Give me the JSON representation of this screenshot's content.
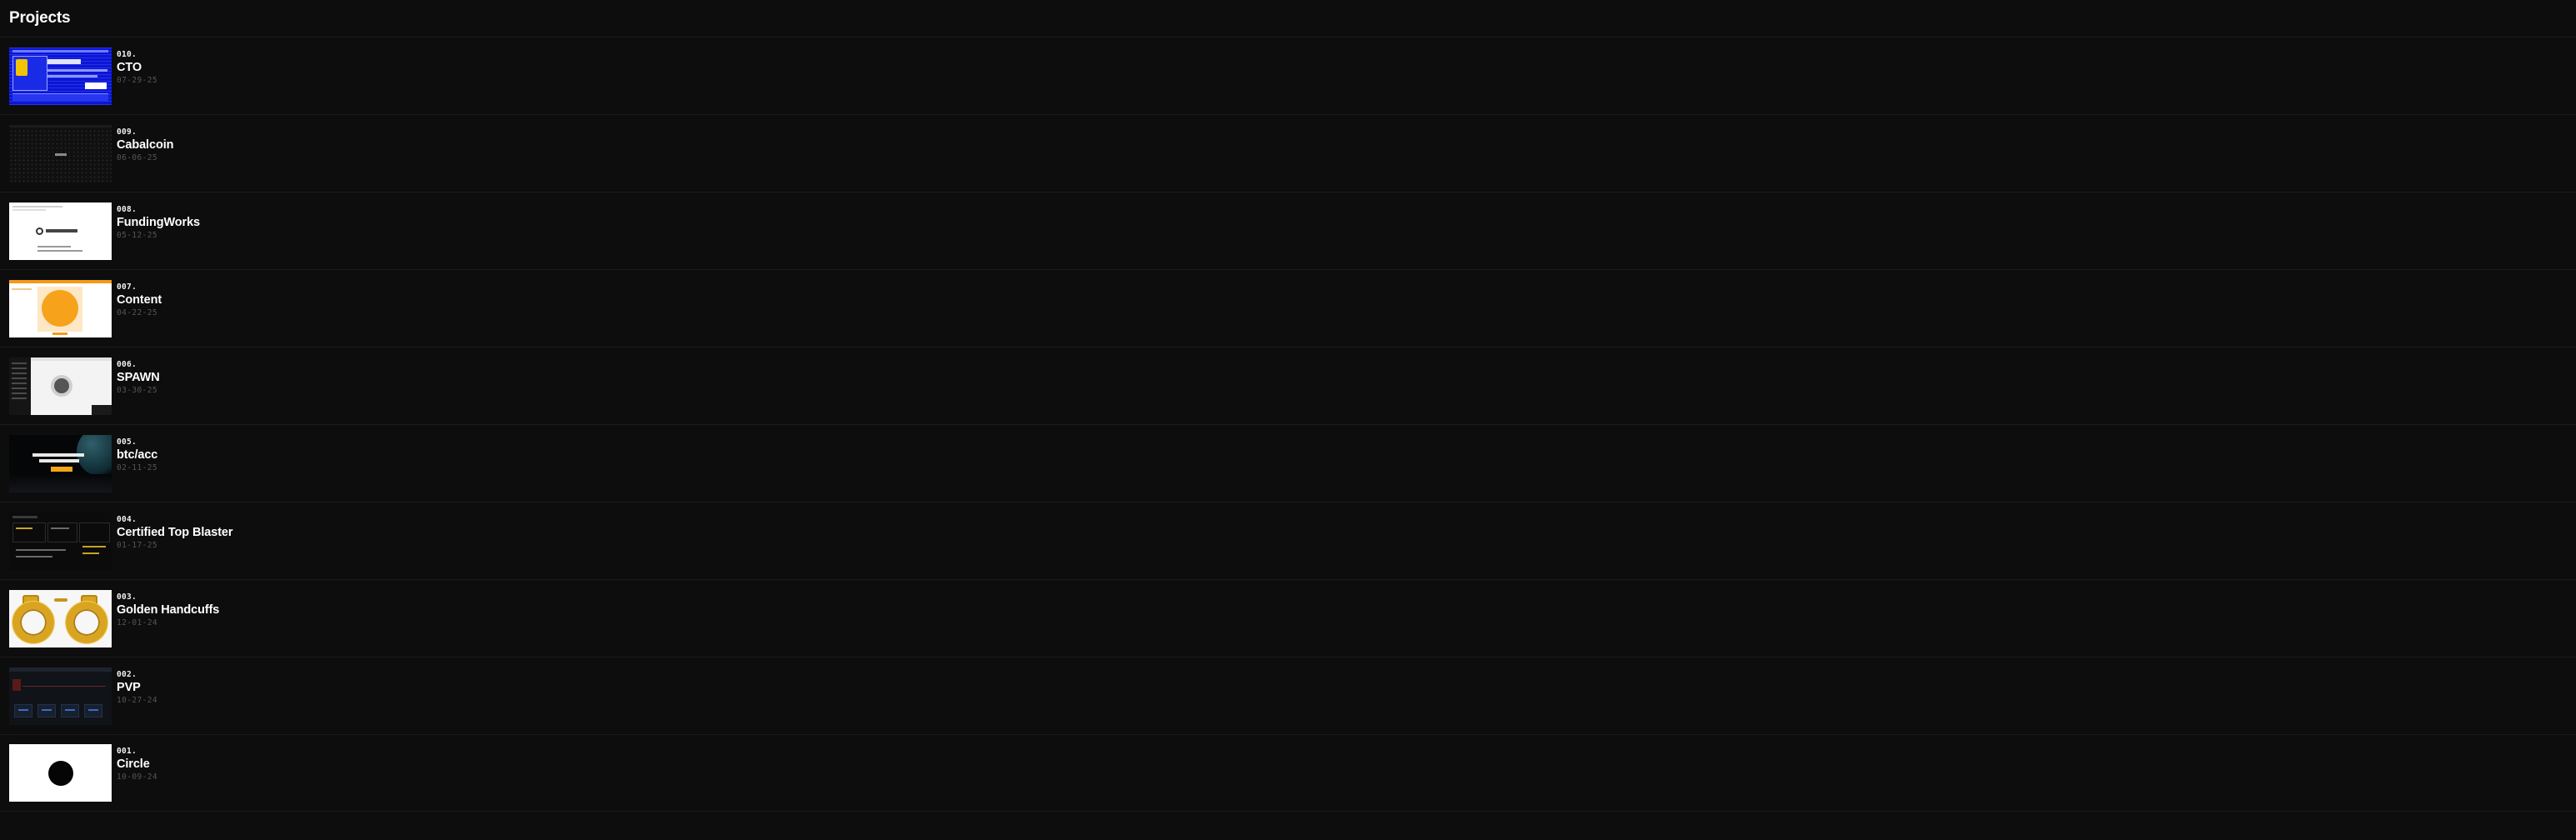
{
  "header": {
    "title": "Projects"
  },
  "projects": [
    {
      "number": "010.",
      "title": "CTO",
      "date": "07-29-25",
      "thumbnail": "cto-thumbnail"
    },
    {
      "number": "009.",
      "title": "Cabalcoin",
      "date": "06-06-25",
      "thumbnail": "cabalcoin-thumbnail"
    },
    {
      "number": "008.",
      "title": "FundingWorks",
      "date": "05-12-25",
      "thumbnail": "fundingworks-thumbnail"
    },
    {
      "number": "007.",
      "title": "Content",
      "date": "04-22-25",
      "thumbnail": "content-thumbnail"
    },
    {
      "number": "006.",
      "title": "SPAWN",
      "date": "03-30-25",
      "thumbnail": "spawn-thumbnail"
    },
    {
      "number": "005.",
      "title": "btc/acc",
      "date": "02-11-25",
      "thumbnail": "btcacc-thumbnail"
    },
    {
      "number": "004.",
      "title": "Certified Top Blaster",
      "date": "01-17-25",
      "thumbnail": "certified-top-blaster-thumbnail"
    },
    {
      "number": "003.",
      "title": "Golden Handcuffs",
      "date": "12-01-24",
      "thumbnail": "golden-handcuffs-thumbnail"
    },
    {
      "number": "002.",
      "title": "PVP",
      "date": "10-27-24",
      "thumbnail": "pvp-thumbnail"
    },
    {
      "number": "001.",
      "title": "Circle",
      "date": "10-09-24",
      "thumbnail": "circle-thumbnail"
    }
  ]
}
